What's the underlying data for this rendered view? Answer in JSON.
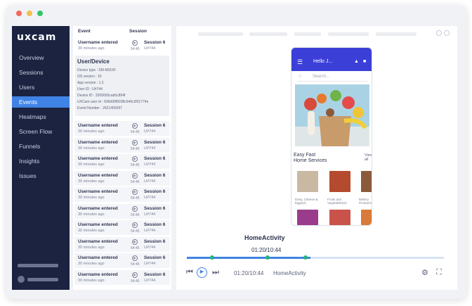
{
  "brand": {
    "logo": "uxcam",
    "accent": "#3f83e6",
    "sidebar_bg": "#1b2340"
  },
  "nav": [
    {
      "label": "Overview",
      "active": false
    },
    {
      "label": "Sessions",
      "active": false
    },
    {
      "label": "Users",
      "active": false
    },
    {
      "label": "Events",
      "active": true
    },
    {
      "label": "Heatmaps",
      "active": false
    },
    {
      "label": "Screen Flow",
      "active": false
    },
    {
      "label": "Funnels",
      "active": false
    },
    {
      "label": "Insights",
      "active": false
    },
    {
      "label": "Issues",
      "active": false
    }
  ],
  "events_panel": {
    "col_event": "Event",
    "col_session": "Session",
    "first": {
      "title": "Username entered",
      "ago": "30 minutes ago",
      "time": "54:45",
      "session": "Session 6",
      "user": "U#744"
    },
    "user_device": {
      "heading": "User/Device",
      "lines": [
        "Device type : SM-M315F",
        "OS version : 10",
        "App version : 1.2",
        "User ID : U#744",
        "Device ID : 3200093cab5c894f",
        "UXCam user id : 606d90f6038c540c3f31774e",
        "Event Number : 2621455097"
      ]
    },
    "rows": [
      {
        "title": "Username entered",
        "ago": "30 minutes ago",
        "time": "54:45",
        "session": "Session 6",
        "user": "U#744"
      },
      {
        "title": "Username entered",
        "ago": "30 minutes ago",
        "time": "54:45",
        "session": "Session 6",
        "user": "U#744"
      },
      {
        "title": "Username entered",
        "ago": "30 minutes ago",
        "time": "54:45",
        "session": "Session 6",
        "user": "U#744"
      },
      {
        "title": "Username entered",
        "ago": "30 minutes ago",
        "time": "54:45",
        "session": "Session 6",
        "user": "U#744"
      },
      {
        "title": "Username entered",
        "ago": "30 minutes ago",
        "time": "54:45",
        "session": "Session 6",
        "user": "U#744"
      },
      {
        "title": "Username entered",
        "ago": "30 minutes ago",
        "time": "54:45",
        "session": "Session 6",
        "user": "U#744"
      },
      {
        "title": "Username entered",
        "ago": "30 minutes ago",
        "time": "54:45",
        "session": "Session 6",
        "user": "U#744"
      },
      {
        "title": "Username entered",
        "ago": "30 minutes ago",
        "time": "54:45",
        "session": "Session 6",
        "user": "U#744"
      },
      {
        "title": "Username entered",
        "ago": "30 minutes ago",
        "time": "54:45",
        "session": "Session 6",
        "user": "U#744"
      },
      {
        "title": "Username entered",
        "ago": "30 minutes ago",
        "time": "54:45",
        "session": "Session 6",
        "user": "U#744"
      }
    ]
  },
  "phone": {
    "greeting": "Hello J...",
    "search_placeholder": "Search...",
    "section_title_1": "Easy Fast",
    "section_title_2": "Home Services",
    "view_all": "View all",
    "categories": [
      "Dairy, Cheese & Eggs(2)",
      "Fruits and Vegetables(2)",
      "Bakery Products(2)"
    ],
    "header_color": "#3b3fd8"
  },
  "player": {
    "screen_label": "HomeActivity",
    "timestamp": "01:20/10:44",
    "bottom_time": "01:20/10:44",
    "bottom_screen": "HomeActivity",
    "progress": 0.48
  }
}
